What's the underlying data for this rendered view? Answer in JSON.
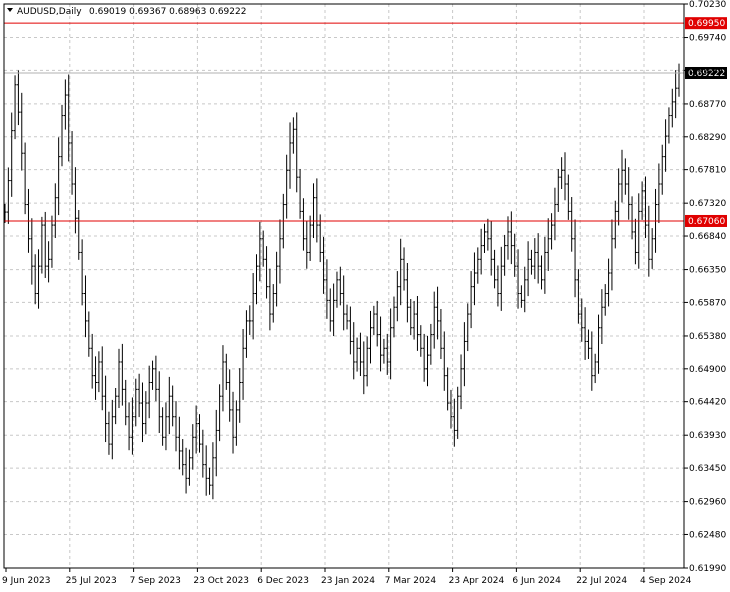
{
  "header": {
    "symbol_timeframe": "AUDUSD,Daily",
    "ohlc": "0.69019 0.69367 0.68963 0.69222"
  },
  "chart_data": {
    "type": "bar",
    "style": "OHLC bars",
    "ylim": [
      0.6199,
      0.7023
    ],
    "y_ticks": [
      "0.70230",
      "0.69740",
      "0.69260",
      "0.68770",
      "0.68290",
      "0.67810",
      "0.67320",
      "0.66840",
      "0.66350",
      "0.65870",
      "0.65380",
      "0.64900",
      "0.64420",
      "0.63930",
      "0.63450",
      "0.62960",
      "0.62480",
      "0.61990"
    ],
    "x_ticks": [
      "9 Jun 2023",
      "25 Jul 2023",
      "7 Sep 2023",
      "23 Oct 2023",
      "6 Dec 2023",
      "23 Jan 2024",
      "7 Mar 2024",
      "23 Apr 2024",
      "6 Jun 2024",
      "22 Jul 2024",
      "4 Sep 2024"
    ],
    "grid": true,
    "horizontal_lines": [
      {
        "label": "0.69950",
        "value": 0.6995,
        "color": "#e00000"
      },
      {
        "label": "0.67060",
        "value": 0.6706,
        "color": "#e00000"
      }
    ],
    "current_price": {
      "label": "0.69222",
      "value": 0.69222,
      "color": "#000000"
    },
    "series": [
      {
        "values": [
          0.6719,
          0.6765,
          0.6838,
          0.6905,
          0.6865,
          0.6805,
          0.673,
          0.668,
          0.664,
          0.66,
          0.664,
          0.67,
          0.664,
          0.665,
          0.67,
          0.674,
          0.68,
          0.686,
          0.689,
          0.682,
          0.676,
          0.671,
          0.666,
          0.66,
          0.656,
          0.652,
          0.648,
          0.647,
          0.65,
          0.645,
          0.641,
          0.638,
          0.642,
          0.645,
          0.65,
          0.646,
          0.642,
          0.639,
          0.642,
          0.646,
          0.644,
          0.641,
          0.644,
          0.647,
          0.649,
          0.646,
          0.642,
          0.639,
          0.642,
          0.645,
          0.642,
          0.639,
          0.637,
          0.635,
          0.633,
          0.636,
          0.639,
          0.641,
          0.638,
          0.635,
          0.633,
          0.632,
          0.636,
          0.64,
          0.645,
          0.65,
          0.647,
          0.643,
          0.639,
          0.643,
          0.647,
          0.652,
          0.656,
          0.656,
          0.66,
          0.664,
          0.668,
          0.665,
          0.661,
          0.657,
          0.66,
          0.664,
          0.668,
          0.673,
          0.678,
          0.682,
          0.684,
          0.677,
          0.672,
          0.668,
          0.666,
          0.67,
          0.674,
          0.67,
          0.666,
          0.662,
          0.659,
          0.656,
          0.659,
          0.662,
          0.66,
          0.657,
          0.656,
          0.653,
          0.65,
          0.652,
          0.65,
          0.648,
          0.652,
          0.655,
          0.657,
          0.654,
          0.651,
          0.652,
          0.65,
          0.655,
          0.658,
          0.661,
          0.665,
          0.662,
          0.658,
          0.655,
          0.657,
          0.654,
          0.652,
          0.649,
          0.651,
          0.654,
          0.658,
          0.656,
          0.652,
          0.648,
          0.644,
          0.642,
          0.64,
          0.645,
          0.649,
          0.653,
          0.657,
          0.661,
          0.663,
          0.665,
          0.667,
          0.669,
          0.668,
          0.665,
          0.662,
          0.66,
          0.664,
          0.667,
          0.669,
          0.667,
          0.664,
          0.66,
          0.659,
          0.662,
          0.665,
          0.664,
          0.666,
          0.664,
          0.662,
          0.666,
          0.668,
          0.67,
          0.673,
          0.677,
          0.678,
          0.676,
          0.672,
          0.668,
          0.662,
          0.657,
          0.655,
          0.653,
          0.652,
          0.648,
          0.65,
          0.655,
          0.658,
          0.66,
          0.663,
          0.668,
          0.672,
          0.676,
          0.678,
          0.676,
          0.673,
          0.669,
          0.666,
          0.672,
          0.675,
          0.67,
          0.665,
          0.668,
          0.673,
          0.676,
          0.68,
          0.683,
          0.686,
          0.688,
          0.69,
          0.6922
        ]
      }
    ]
  }
}
